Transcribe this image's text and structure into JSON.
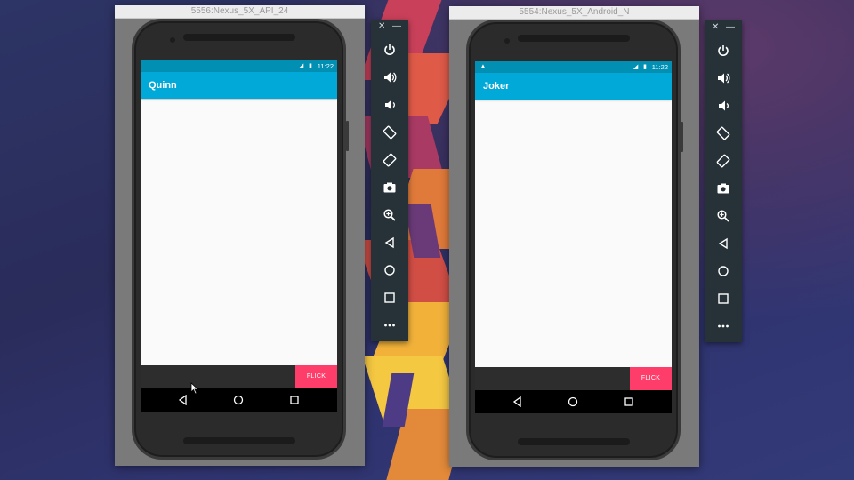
{
  "emulators": [
    {
      "window_title": "5556:Nexus_5X_API_24",
      "status_time": "11:22",
      "status_icons": "◢ ▮",
      "status_warning": "",
      "app_title": "Quinn",
      "flick_label": "FLICK"
    },
    {
      "window_title": "5554:Nexus_5X_Android_N",
      "status_time": "11:22",
      "status_icons": "◢ ▮",
      "status_warning": "▲",
      "app_title": "Joker",
      "flick_label": "FLICK"
    }
  ],
  "toolbar": {
    "close_label": "✕",
    "minimize_label": "—",
    "buttons": [
      "power-icon",
      "volume-up-icon",
      "volume-down-icon",
      "rotate-left-icon",
      "rotate-right-icon",
      "camera-icon",
      "zoom-icon",
      "back-icon",
      "home-icon",
      "overview-icon",
      "more-icon"
    ]
  },
  "colors": {
    "status_bar": "#0190b4",
    "app_bar": "#00a9d8",
    "flick_button": "#ff3d6a",
    "toolbar_bg": "#263238"
  }
}
